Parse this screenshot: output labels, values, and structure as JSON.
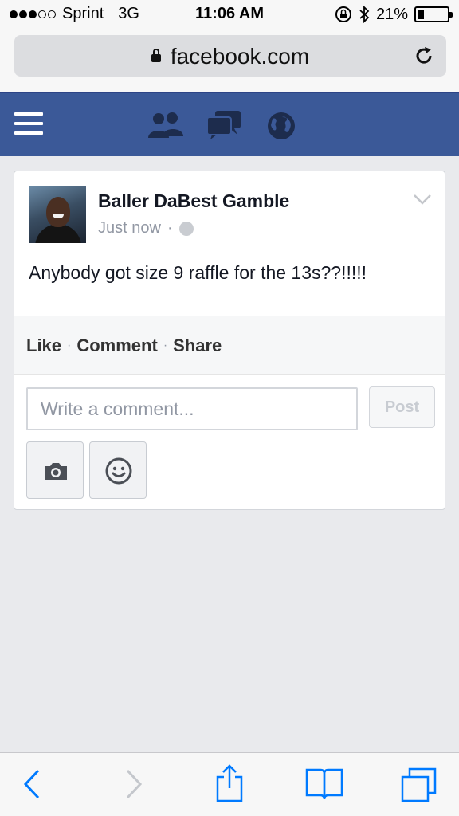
{
  "status_bar": {
    "carrier": "Sprint",
    "network": "3G",
    "time": "11:06 AM",
    "battery": "21%",
    "battery_level": 0.21
  },
  "address_bar": {
    "url": "facebook.com",
    "icons": [
      "lock-icon",
      "reload-icon"
    ]
  },
  "fb_nav": {
    "background": "#3b5998",
    "icons": [
      "menu-icon",
      "friend-requests-icon",
      "messages-icon",
      "notifications-globe-icon"
    ]
  },
  "post": {
    "author": "Baller DaBest Gamble",
    "timestamp": "Just now",
    "separator": "·",
    "text": "Anybody got size 9 raffle for the 13s??!!!!!",
    "actions": {
      "like": "Like",
      "comment": "Comment",
      "share": "Share",
      "dot": "·"
    },
    "comment_placeholder": "Write a comment...",
    "post_label": "Post"
  },
  "toolbar": {
    "icons": [
      "back-icon",
      "forward-icon",
      "share-icon",
      "bookmarks-icon",
      "tabs-icon"
    ],
    "accent": "#007aff"
  }
}
